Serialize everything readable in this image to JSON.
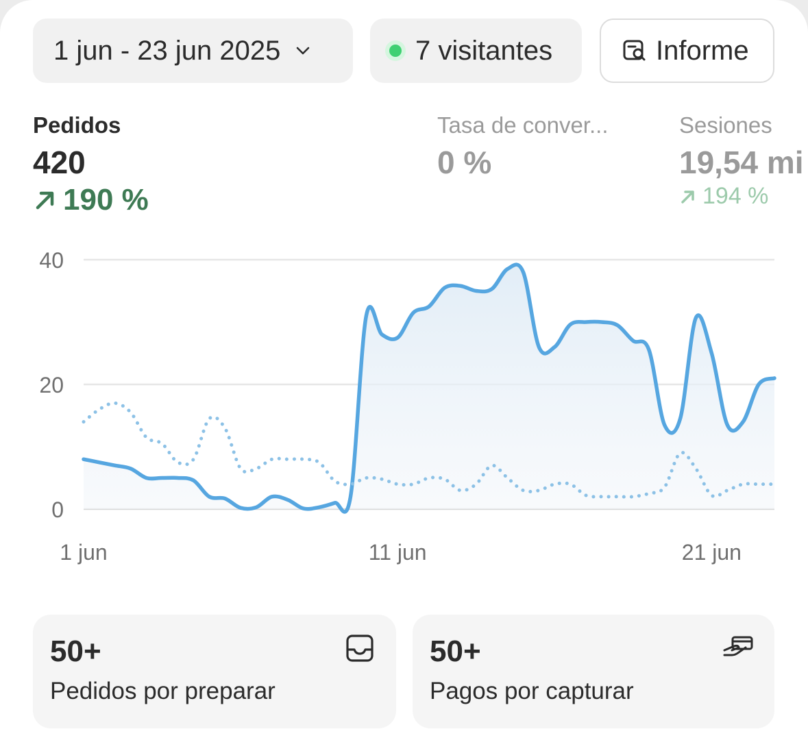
{
  "toolbar": {
    "date_range": "1 jun - 23 jun 2025",
    "visitors": "7 visitantes",
    "report_label": "Informe"
  },
  "metrics": [
    {
      "label": "Pedidos",
      "value": "420",
      "delta": "190 %",
      "trend": "up",
      "selected": true
    },
    {
      "label": "Tasa de conver...",
      "value": "0 %",
      "delta": "",
      "selected": false
    },
    {
      "label": "Sesiones",
      "value": "19,54 mi",
      "delta": "194 %",
      "trend": "up",
      "selected": false
    }
  ],
  "chart_data": {
    "type": "line",
    "y_ticks": [
      "0",
      "20",
      "40"
    ],
    "ylim": [
      0,
      40
    ],
    "x_tick_labels": [
      "1 jun",
      "11 jun",
      "21 jun"
    ],
    "grid": true,
    "series": [
      {
        "style": "solid",
        "color": "#56a6e0",
        "x": [
          1,
          1.5,
          2,
          2.5,
          3,
          3.5,
          4,
          4.5,
          5,
          5.5,
          6,
          6.5,
          7,
          7.5,
          8,
          8.5,
          9,
          9.5,
          10,
          10.5,
          11,
          11.5,
          12,
          12.5,
          13,
          13.5,
          14,
          14.5,
          15,
          15.5,
          16,
          16.5,
          17,
          17.5,
          18,
          18.5,
          19,
          19.5,
          20,
          20.5,
          21,
          21.5,
          22,
          22.5,
          23
        ],
        "values": [
          8,
          7.5,
          7,
          6.5,
          5,
          5,
          5,
          4.6,
          2,
          1.7,
          0.2,
          0.3,
          2,
          1.5,
          0.1,
          0.3,
          1,
          2,
          31,
          28,
          27.5,
          31.5,
          32.5,
          35.5,
          35.8,
          35,
          35.3,
          38.5,
          38,
          26,
          26,
          29.6,
          30,
          30,
          29.5,
          27,
          25.6,
          13.5,
          14.5,
          30.7,
          25,
          13.5,
          14,
          20,
          21
        ]
      },
      {
        "style": "dotted",
        "color": "#8cc1e6",
        "x": [
          1,
          1.5,
          2,
          2.5,
          3,
          3.5,
          4,
          4.5,
          5,
          5.5,
          6,
          6.5,
          7,
          7.5,
          8,
          8.5,
          9,
          9.5,
          10,
          10.5,
          11,
          11.5,
          12,
          12.5,
          13,
          13.5,
          14,
          14.5,
          15,
          15.5,
          16,
          16.5,
          17,
          17.5,
          18,
          18.5,
          19,
          19.5,
          20,
          20.5,
          21,
          21.5,
          22,
          22.5,
          23
        ],
        "values": [
          14,
          16,
          17,
          15.5,
          11.5,
          10.5,
          7.5,
          8,
          14.5,
          13,
          6.5,
          6.5,
          8,
          8,
          8,
          7.5,
          4.5,
          4,
          5,
          4.8,
          4,
          4,
          5,
          4.8,
          3,
          4,
          7,
          5,
          3,
          3,
          4,
          4,
          2.2,
          2,
          2,
          2,
          2.5,
          3.5,
          9,
          6.5,
          2.2,
          3,
          4,
          4,
          4
        ]
      }
    ]
  },
  "tiles": [
    {
      "count": "50+",
      "label": "Pedidos por preparar",
      "icon": "inbox-icon"
    },
    {
      "count": "50+",
      "label": "Pagos por capturar",
      "icon": "payment-hand-icon"
    }
  ]
}
